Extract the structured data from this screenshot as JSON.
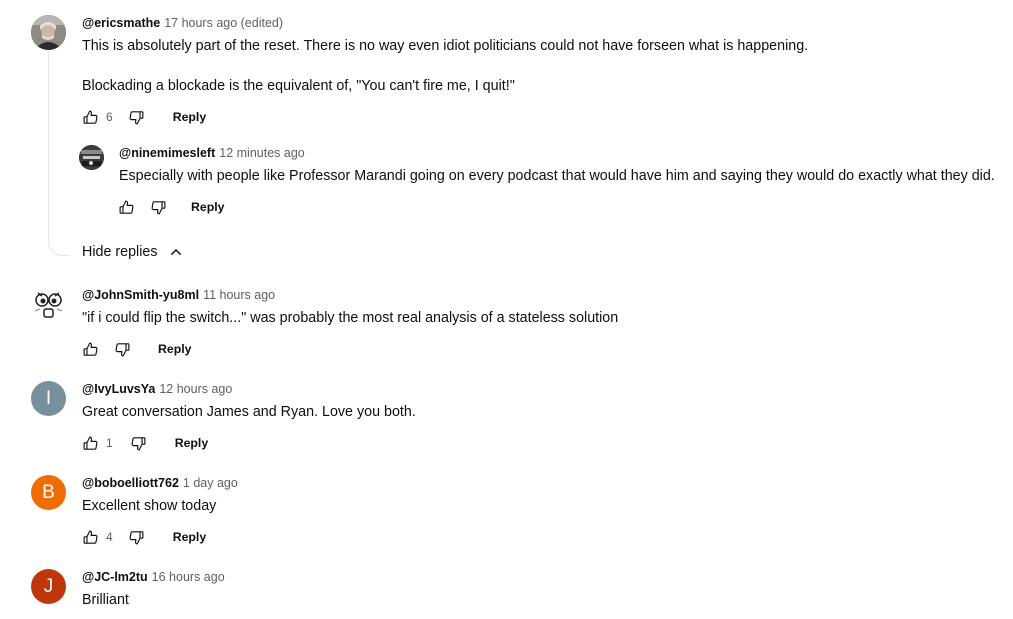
{
  "comments": [
    {
      "author": "@ericsmathe",
      "time": "17 hours ago (edited)",
      "text_lines": [
        "This is absolutely part of the reset. There is no way even idiot politicians could not have forseen what is happening.",
        "Blockading a blockade is the equivalent of, \"You can't fire me, I quit!\""
      ],
      "likes": "6",
      "reply_label": "Reply",
      "avatar_icon": "photo-avatar"
    },
    {
      "author": "@JohnSmith-yu8ml",
      "time": "11 hours ago",
      "text_lines": [
        "\"if i could flip the switch...\" was probably the most real analysis of a stateless solution"
      ],
      "likes": "",
      "reply_label": "Reply",
      "avatar_icon": "cartoon-face-avatar"
    },
    {
      "author": "@IvyLuvsYa",
      "time": "12 hours ago",
      "text_lines": [
        "Great conversation James and Ryan. Love you both."
      ],
      "likes": "1",
      "reply_label": "Reply",
      "avatar_letter": "I",
      "avatar_color": "#78909c"
    },
    {
      "author": "@boboelliott762",
      "time": "1 day ago",
      "text_lines": [
        "Excellent show today"
      ],
      "likes": "4",
      "reply_label": "Reply",
      "avatar_letter": "B",
      "avatar_color": "#ef6c00"
    },
    {
      "author": "@JC-lm2tu",
      "time": "16 hours ago",
      "text_lines": [
        "Brilliant"
      ],
      "avatar_letter": "J",
      "avatar_color": "#bf360c"
    }
  ],
  "reply": {
    "author": "@ninemimesleft",
    "time": "12 minutes ago",
    "text": "Especially with people like Professor Marandi going on every podcast that would have him and saying they would do exactly what they did.",
    "reply_label": "Reply",
    "avatar_icon": "photo-avatar"
  },
  "hide_replies_label": "Hide replies",
  "colors": {
    "text": "#0f0f0f",
    "secondary": "#606060",
    "divider": "#e5e5e5"
  }
}
